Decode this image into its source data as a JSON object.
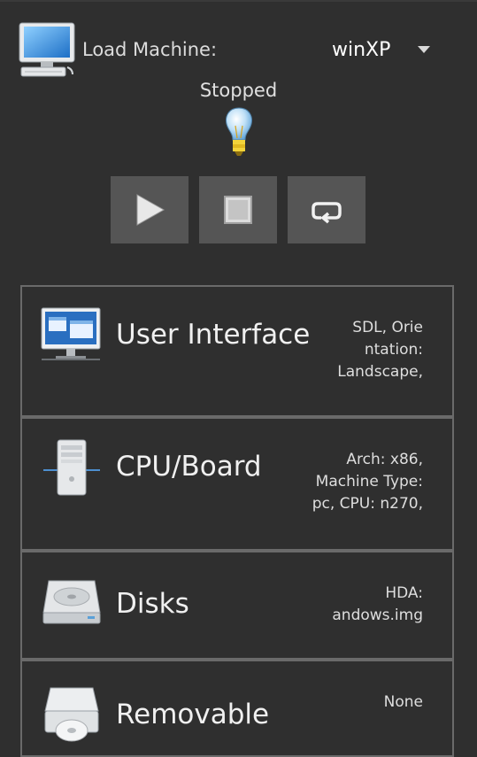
{
  "header": {
    "load_label": "Load Machine:",
    "machine_value": "winXP",
    "status": "Stopped",
    "machine_icon": "computer-icon",
    "status_icon": "lightbulb-icon"
  },
  "controls": {
    "play_icon": "play-icon",
    "stop_icon": "stop-icon",
    "restart_icon": "restart-icon"
  },
  "sections": [
    {
      "title": "User Interface",
      "summary": "SDL, Orie\nntation:\nLandscape,",
      "icon": "monitor-icon"
    },
    {
      "title": "CPU/Board",
      "summary": "Arch: x86,\nMachine Type:\npc, CPU: n270,",
      "icon": "tower-computer-icon"
    },
    {
      "title": "Disks",
      "summary": "HDA: andows.img",
      "icon": "hard-disk-icon"
    },
    {
      "title": "Removable",
      "summary": "None",
      "icon": "cdrom-drive-icon"
    }
  ],
  "colors": {
    "background": "#2f2f2f",
    "button": "#555555",
    "border": "#6a6a6a"
  }
}
